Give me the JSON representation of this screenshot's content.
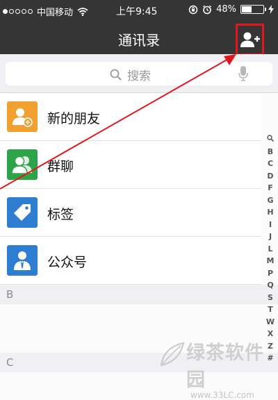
{
  "status_bar": {
    "carrier": "中国移动",
    "time": "上午9:45",
    "battery_percent": "48%",
    "battery_level": 0.48,
    "signal_bars_filled": 1,
    "signal_bars_total": 5
  },
  "nav": {
    "title": "通讯录",
    "add_icon": "add-friend-icon"
  },
  "search": {
    "placeholder": "搜索"
  },
  "list": {
    "items": [
      {
        "label": "新的朋友",
        "icon": "new-friend-icon",
        "color": "#f0a130"
      },
      {
        "label": "群聊",
        "icon": "group-chat-icon",
        "color": "#2fa34a"
      },
      {
        "label": "标签",
        "icon": "tag-icon",
        "color": "#2d7ed0"
      },
      {
        "label": "公众号",
        "icon": "official-account-icon",
        "color": "#2d7ed0"
      }
    ]
  },
  "sections": [
    "B",
    "C"
  ],
  "index": [
    "Q",
    "B",
    "C",
    "D",
    "F",
    "G",
    "H",
    "I",
    "J",
    "L",
    "M",
    "P",
    "Q",
    "S",
    "T",
    "W",
    "X",
    "Z",
    "#"
  ],
  "watermark": {
    "title": "绿茶软件园",
    "url": "www.33LC.com"
  },
  "colors": {
    "header": "#353535",
    "highlight": "#e0171c",
    "background": "#efeff4"
  }
}
